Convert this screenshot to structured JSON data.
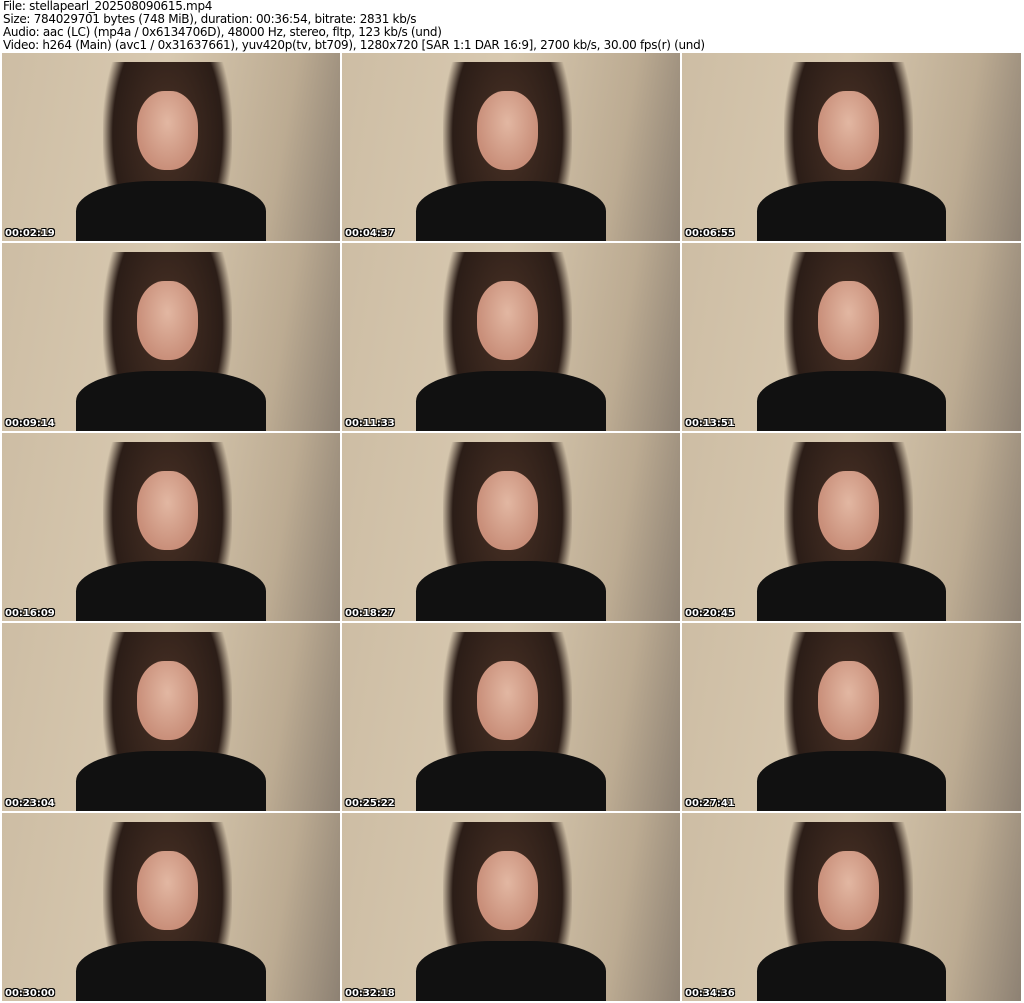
{
  "header": {
    "file": "File: stellapearl_202508090615.mp4",
    "size": "Size: 784029701 bytes (748 MiB), duration: 00:36:54, bitrate: 2831 kb/s",
    "audio": "Audio: aac (LC) (mp4a / 0x6134706D), 48000 Hz, stereo, fltp, 123 kb/s (und)",
    "video": "Video: h264 (Main) (avc1 / 0x31637661), yuv420p(tv, bt709), 1280x720 [SAR 1:1 DAR 16:9], 2700 kb/s, 30.00 fps(r) (und)"
  },
  "thumbnails": [
    "00:02:19",
    "00:04:37",
    "00:06:55",
    "00:09:14",
    "00:11:33",
    "00:13:51",
    "00:16:09",
    "00:18:27",
    "00:20:45",
    "00:23:04",
    "00:25:22",
    "00:27:41",
    "00:30:00",
    "00:32:18",
    "00:34:36"
  ]
}
